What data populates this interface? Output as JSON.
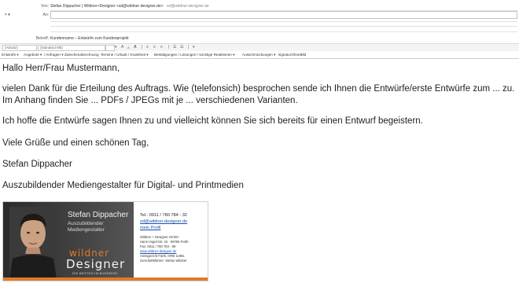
{
  "header": {
    "from_label": "Von:",
    "from_value": "Stefan Dippacher | Wildner+Designer <sd@wildner-designer.de>",
    "from_alias": "sd@wildner-designer.de",
    "to_label": "An:",
    "to_value": "",
    "subject_label": "Betreff:",
    "subject_value": "Kundenname – Entwürfe zum Kundenprojekt",
    "cc_toggle": "× ▾"
  },
  "format_bar": {
    "style": "(Absatz)",
    "font": "(Standard M5)",
    "size": "",
    "tools": [
      "▾",
      "A",
      "A",
      "A",
      "|",
      "≡",
      "≡",
      "≡",
      "|",
      "☰",
      "☰",
      "|",
      "▾"
    ]
  },
  "template_bar": {
    "items": [
      "Entwürfe ▾",
      "Angebote ▾",
      "/ Anfragen ▾",
      "Zwischenabrechnung",
      "Termine / Urlaub / Krankheit ▾",
      "Bestätigungen / Lösungen / sonstige Reaktionen ▾",
      "Ausschmückungen ▾",
      "signaturOhneBild"
    ]
  },
  "body": {
    "greeting": "Hallo Herr/Frau Mustermann,",
    "para1_line1": "vielen Dank für die Erteilung des Auftrags. Wie (telefonsich) besprochen sende ich Ihnen die Entwürfe/erste Entwürfe zum ... zu.",
    "para1_line2": "Im Anhang finden Sie ... PDFs / JPEGs mit je ... verschiedenen Varianten.",
    "para2": "Ich hoffe die Entwürfe sagen Ihnen zu und vielleicht können Sie sich bereits für einen Entwurf begeistern.",
    "closing": "Viele Grüße und einen schönen Tag,",
    "name": "Stefan Dippacher",
    "role": "Auszubildender Mediengestalter für Digital- und Printmedien"
  },
  "signature": {
    "name": "Stefan Dippacher",
    "sub1": "Auszubildender",
    "sub2": "Mediengestalter",
    "logo_top": "wildner",
    "logo_main": "Designer",
    "tagline": "DIE BESTEN IM BUSINESS.",
    "tel": "Tel.: 0911 / 780 784 - 32",
    "email": "sd@wildner-designer.de",
    "profile": "mein Profil",
    "company": "Wildner + Designer GmbH",
    "street": "Hans-Vogel-Str. 42 · 90765 Fürth",
    "fax": "Fax: 0911 / 780 784 - 99",
    "web": "www.wildner-designer.de",
    "court": "Amtsgericht Fürth, HRB 11981",
    "ceo": "Geschäftsführer: Stefan Wildner"
  },
  "colors": {
    "accent_orange": "#e07b29",
    "link_blue": "#1a4fb0",
    "sig_dark": "#2b2b2b"
  }
}
